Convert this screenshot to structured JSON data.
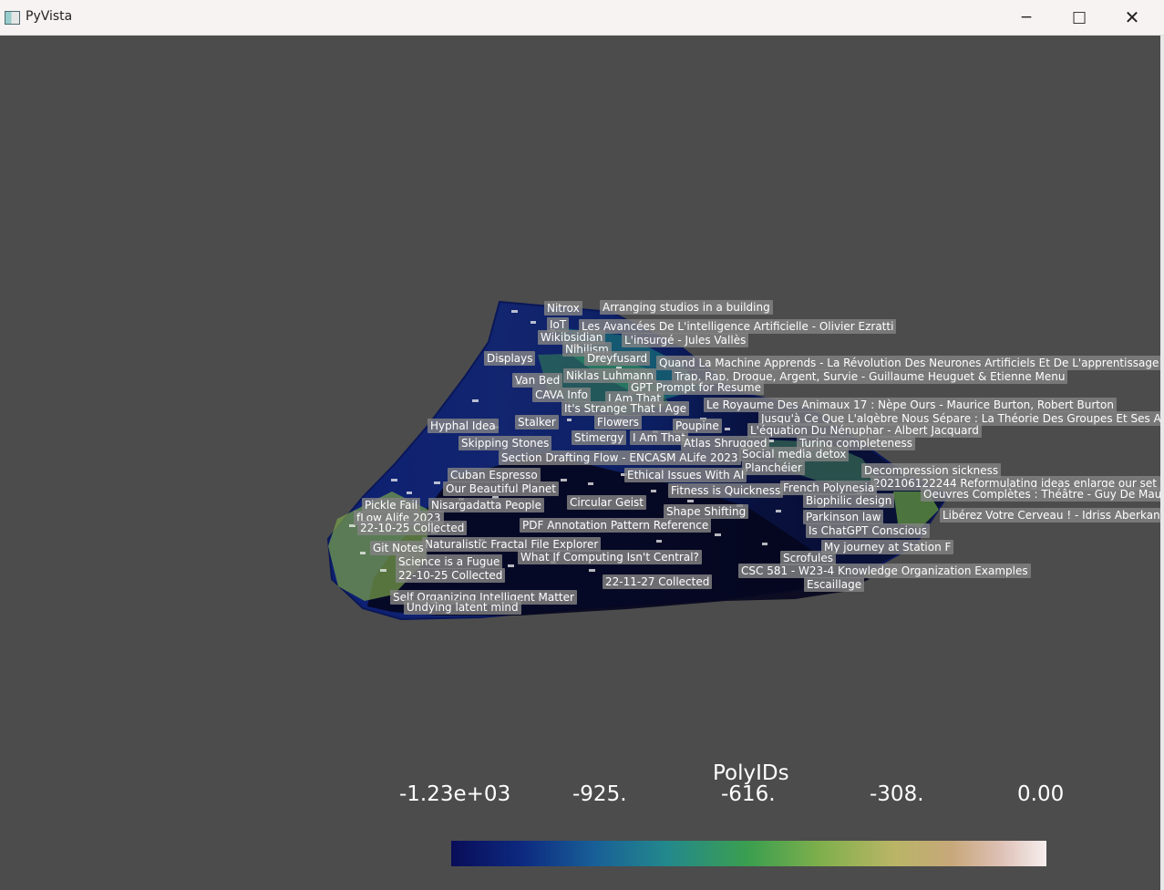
{
  "window": {
    "title": "PyVista",
    "controls": {
      "minimize": "−",
      "maximize": "□",
      "close": "✕"
    }
  },
  "colors": {
    "background": "#4c4c4c",
    "titlebar": "#f8f3f3",
    "label_bg": "#828282",
    "label_text": "#ffffff"
  },
  "labels": [
    "Nitrox",
    "Arranging studios in a building",
    "IoT",
    "Les Avancées De L'intelligence Artificielle - Olivier Ezratti",
    "Wikibsidian",
    "L'insurgé - Jules Vallès",
    "Nihilism",
    "Displays",
    "Dreyfusard",
    "Quand La Machine Apprends - La Révolution Des Neurones Artificiels Et De L'apprentissage Pr",
    "Van Bed",
    "Niklas Luhmann",
    "Trap, Rap, Drogue, Argent, Survie - Guillaume Heuguet & Etienne Menu",
    "GPT Prompt for Resume",
    "CAVA Info",
    "I Am That",
    "It's Strange That I Age",
    "Le Royaume Des Animaux 17 : Nèpe Ours - Maurice Burton, Robert Burton",
    "Jusqu'à Ce Que L'algèbre Nous Sépare : La Théorie Des Groupes Et Ses Ap",
    "Hyphal Idea",
    "Stalker",
    "Flowers",
    "Poupine",
    "L'équation Du Nénuphar - Albert Jacquard",
    "Skipping Stones",
    "Stimergy",
    "I Am That",
    "Atlas Shrugged",
    "Turing completeness",
    "Social media detox",
    "Section Drafting Flow - ENCASM ALife 2023",
    "Planchéier",
    "Decompression sickness",
    "Cuban Espresso",
    "Ethical Issues With AI",
    "202106122244 Reformulating ideas enlarge our set of",
    "Our Beautiful Planet",
    "Fitness is Quickness",
    "French Polynesia",
    "Oeuvres Complètes : Théâtre - Guy De Mau",
    "Biophilic design",
    "Pickle Fail",
    "Nisargadatta People",
    "Circular Geist",
    "Shape Shifting",
    "Libérez Votre Cerveau ! - Idriss Aberkan",
    "fLow Alife 2023",
    "Parkinson law",
    "22-10-25 Collected",
    "PDF Annotation Pattern Reference",
    "Is ChatGPT Conscious",
    "Naturalistic Fractal File Explorer",
    "Git Notes",
    "My journey at Station F",
    "What If Computing Isn't Central?",
    "Science is a Fugue",
    "Scrofules",
    "22-10-25 Collected",
    "CSC 581 - W23-4 Knowledge Organization Examples",
    "22-11-27 Collected",
    "Escaillage",
    "Self Organizing Intelligent Matter",
    "Undying latent mind"
  ],
  "scalar_bar": {
    "title": "PolyIDs",
    "ticks": [
      "-1.23e+03",
      "-925.",
      "-616.",
      "-308.",
      "0.00"
    ],
    "colors": [
      "#090d58",
      "#185f97",
      "#3b9f4f",
      "#b8b565",
      "#f6eeee"
    ]
  }
}
